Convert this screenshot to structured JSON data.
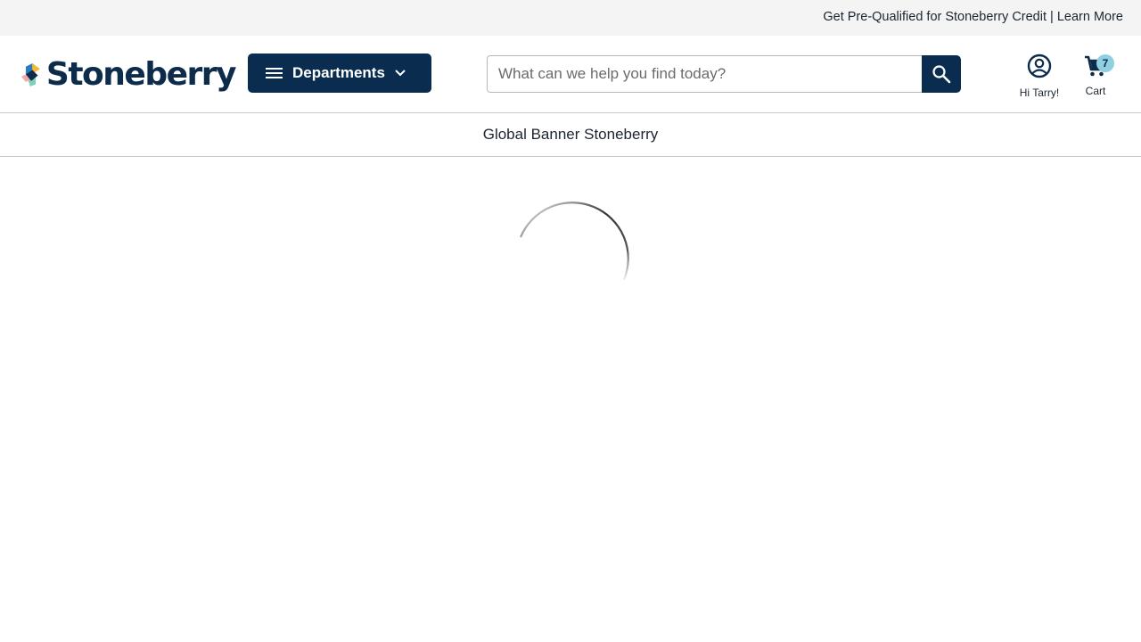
{
  "topbar": {
    "promo_text": "Get Pre-Qualified for Stoneberry Credit",
    "separator": "|",
    "learn_more": "Learn More"
  },
  "header": {
    "logo_text": "Stoneberry",
    "departments_label": "Departments",
    "search_placeholder": "What can we help you find today?",
    "account_label": "Hi Tarry!",
    "cart_label": "Cart",
    "cart_count": "7"
  },
  "banner": {
    "text": "Global Banner Stoneberry"
  },
  "colors": {
    "brand_navy": "#0a2d4f",
    "badge": "#8fcfe0",
    "topbar_bg": "#f4f4f4"
  },
  "icons": {
    "menu": "hamburger-icon",
    "chevron": "chevron-down-icon",
    "search": "search-icon",
    "account": "user-circle-icon",
    "cart": "shopping-cart-icon",
    "loading": "loading-spinner"
  }
}
